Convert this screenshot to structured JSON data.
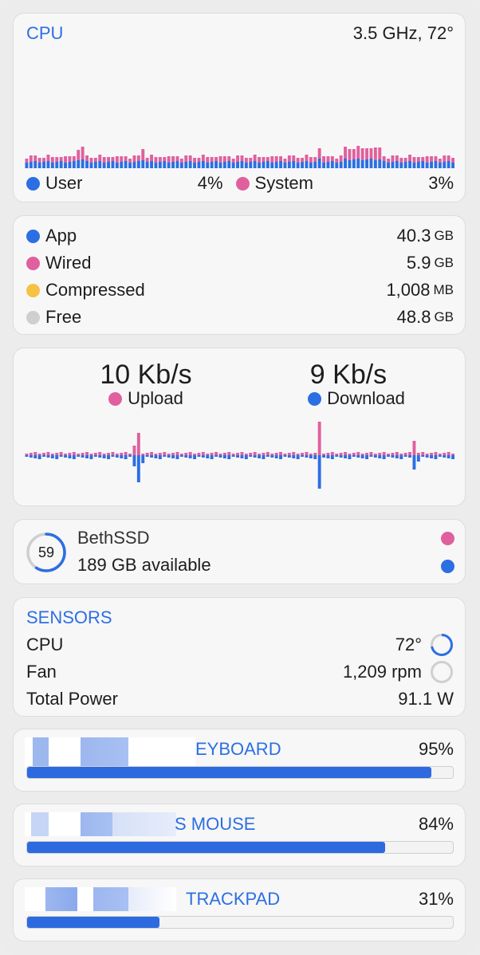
{
  "cpu": {
    "title": "CPU",
    "summary": "3.5 GHz, 72°",
    "user_label": "User",
    "user_value": "4%",
    "system_label": "System",
    "system_value": "3%",
    "colors": {
      "user": "#2c6fe3",
      "system": "#e0609d"
    }
  },
  "memory": {
    "rows": [
      {
        "label": "App",
        "value": "40.3",
        "unit": "GB",
        "color": "#2c6fe3"
      },
      {
        "label": "Wired",
        "value": "5.9",
        "unit": "GB",
        "color": "#e0609d"
      },
      {
        "label": "Compressed",
        "value": "1,008",
        "unit": "MB",
        "color": "#f5c242"
      },
      {
        "label": "Free",
        "value": "48.8",
        "unit": "GB",
        "color": "#cfcfcf"
      }
    ]
  },
  "network": {
    "upload_value": "10 Kb/s",
    "upload_label": "Upload",
    "download_value": "9 Kb/s",
    "download_label": "Download"
  },
  "disk": {
    "percent_text": "59",
    "percent": 0.59,
    "name": "BethSSD",
    "available": "189 GB available"
  },
  "sensors": {
    "title": "SENSORS",
    "rows": [
      {
        "label": "CPU",
        "value": "72°",
        "gauge": 0.72
      },
      {
        "label": "Fan",
        "value": "1,209 rpm",
        "gauge": 0.0
      },
      {
        "label": "Total Power",
        "value": "91.1 W"
      }
    ]
  },
  "batteries": [
    {
      "label_visible": "EYBOARD",
      "percent_text": "95%",
      "percent": 0.95
    },
    {
      "label_visible": "S MOUSE",
      "percent_text": "84%",
      "percent": 0.84
    },
    {
      "label_visible": "TRACKPAD",
      "percent_text": "31%",
      "percent": 0.31
    }
  ]
}
